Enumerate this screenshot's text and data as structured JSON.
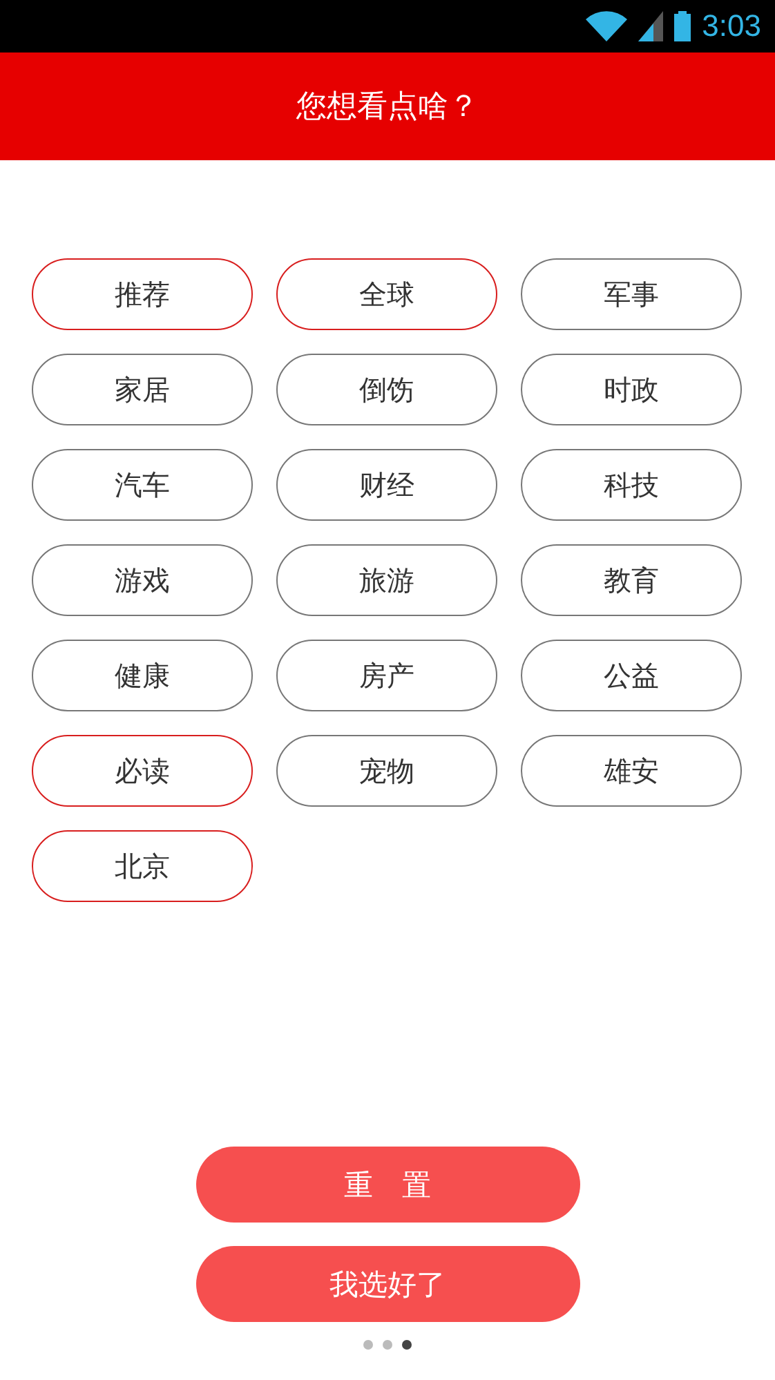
{
  "status_bar": {
    "time": "3:03"
  },
  "header": {
    "title": "您想看点啥？"
  },
  "categories": [
    {
      "label": "推荐",
      "selected": true
    },
    {
      "label": "全球",
      "selected": true
    },
    {
      "label": "军事",
      "selected": false
    },
    {
      "label": "家居",
      "selected": false
    },
    {
      "label": "倒饬",
      "selected": false
    },
    {
      "label": "时政",
      "selected": false
    },
    {
      "label": "汽车",
      "selected": false
    },
    {
      "label": "财经",
      "selected": false
    },
    {
      "label": "科技",
      "selected": false
    },
    {
      "label": "游戏",
      "selected": false
    },
    {
      "label": "旅游",
      "selected": false
    },
    {
      "label": "教育",
      "selected": false
    },
    {
      "label": "健康",
      "selected": false
    },
    {
      "label": "房产",
      "selected": false
    },
    {
      "label": "公益",
      "selected": false
    },
    {
      "label": "必读",
      "selected": true
    },
    {
      "label": "宠物",
      "selected": false
    },
    {
      "label": "雄安",
      "selected": false
    },
    {
      "label": "北京",
      "selected": true
    }
  ],
  "buttons": [
    {
      "label": "重　置"
    },
    {
      "label": "我选好了"
    }
  ],
  "page_dots": [
    {
      "selected": false
    },
    {
      "selected": false
    },
    {
      "selected": true
    }
  ]
}
